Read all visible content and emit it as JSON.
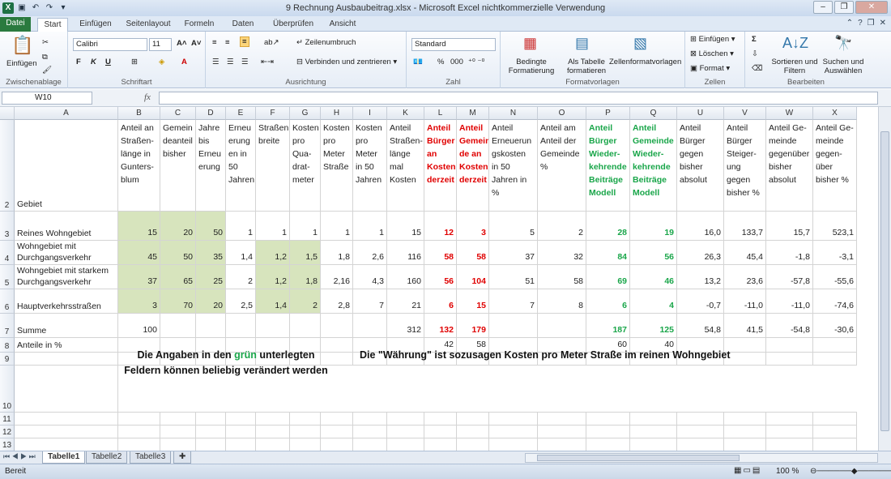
{
  "window": {
    "title": "9 Rechnung Ausbaubeitrag.xlsx  -  Microsoft Excel nichtkommerzielle Verwendung"
  },
  "ribbon_tabs": [
    {
      "label": "Datei"
    },
    {
      "label": "Start"
    },
    {
      "label": "Einfügen"
    },
    {
      "label": "Seitenlayout"
    },
    {
      "label": "Formeln"
    },
    {
      "label": "Daten"
    },
    {
      "label": "Überprüfen"
    },
    {
      "label": "Ansicht"
    }
  ],
  "ribbon": {
    "clipboard": {
      "label": "Zwischenablage",
      "paste": "Einfügen"
    },
    "font": {
      "label": "Schriftart",
      "name": "Calibri",
      "size": "11",
      "bold": "F",
      "italic": "K",
      "underline": "U"
    },
    "alignment": {
      "label": "Ausrichtung",
      "wrap": "Zeilenumbruch",
      "merge": "Verbinden und zentrieren"
    },
    "number": {
      "label": "Zahl",
      "format": "Standard",
      "percent": "%",
      "thousands": "000"
    },
    "styles": {
      "label": "Formatvorlagen",
      "conditional": "Bedingte Formatierung",
      "table": "Als Tabelle formatieren",
      "cell": "Zellenformatvorlagen"
    },
    "cells": {
      "label": "Zellen",
      "insert": "Einfügen",
      "delete": "Löschen",
      "format": "Format"
    },
    "editing": {
      "label": "Bearbeiten",
      "sum": "Σ",
      "sort": "Sortieren und Filtern",
      "find": "Suchen und Auswählen"
    }
  },
  "formula_bar": {
    "name_box": "W10",
    "fx": "fx",
    "value": ""
  },
  "columns": [
    "A",
    "B",
    "C",
    "D",
    "E",
    "F",
    "G",
    "H",
    "I",
    "K",
    "L",
    "M",
    "N",
    "O",
    "P",
    "Q",
    "U",
    "V",
    "W",
    "X"
  ],
  "row_numbers": [
    "2",
    "3",
    "4",
    "5",
    "6",
    "7",
    "8",
    "9",
    "10",
    "11",
    "12",
    "13"
  ],
  "headers": {
    "A": "Gebiet",
    "B": "Anteil an Straßen-länge in Gunters-blum",
    "C": "Gemein deanteil bisher",
    "D": "Jahre bis Erneu erung",
    "E": "Erneu erung en in 50 Jahren",
    "F": "Straßen breite",
    "G": "Kosten pro Qua-drat-meter",
    "H": "Kosten pro Meter Straße",
    "I": "Kosten pro Meter in 50 Jahren",
    "K": "Anteil Straßen-länge mal Kosten",
    "L": "Anteil Bürger an Kosten derzeit",
    "M": "Anteil Gemein de an Kosten derzeit",
    "N": "Anteil Erneuerun gskosten in 50 Jahren in %",
    "O": "Anteil am Anteil der Gemeinde %",
    "P": "Anteil Bürger Wieder-kehrende Beiträge Modell",
    "Q": "Anteil Gemeinde Wieder-kehrende Beiträge Modell",
    "U": "Anteil Bürger gegen bisher absolut",
    "V": "Anteil Bürger Steiger-ung gegen bisher %",
    "W": "Anteil Ge-meinde gegenüber bisher absolut",
    "X": "Anteil Ge-meinde gegen-über bisher %"
  },
  "rows": [
    {
      "A": "Reines Wohngebiet",
      "B": "15",
      "C": "20",
      "D": "50",
      "E": "1",
      "F": "1",
      "G": "1",
      "H": "1",
      "I": "1",
      "K": "15",
      "L": "12",
      "M": "3",
      "N": "5",
      "O": "2",
      "P": "28",
      "Q": "19",
      "U": "16,0",
      "V": "133,7",
      "W": "15,7",
      "X": "523,1"
    },
    {
      "A": "Wohngebiet mit Durchgangsverkehr",
      "B": "45",
      "C": "50",
      "D": "35",
      "E": "1,4",
      "F": "1,2",
      "G": "1,5",
      "H": "1,8",
      "I": "2,6",
      "K": "116",
      "L": "58",
      "M": "58",
      "N": "37",
      "O": "32",
      "P": "84",
      "Q": "56",
      "U": "26,3",
      "V": "45,4",
      "W": "-1,8",
      "X": "-3,1"
    },
    {
      "A": "Wohngebiet mit starkem Durchgangsverkehr",
      "B": "37",
      "C": "65",
      "D": "25",
      "E": "2",
      "F": "1,2",
      "G": "1,8",
      "H": "2,16",
      "I": "4,3",
      "K": "160",
      "L": "56",
      "M": "104",
      "N": "51",
      "O": "58",
      "P": "69",
      "Q": "46",
      "U": "13,2",
      "V": "23,6",
      "W": "-57,8",
      "X": "-55,6"
    },
    {
      "A": "Hauptverkehrsstraßen",
      "B": "3",
      "C": "70",
      "D": "20",
      "E": "2,5",
      "F": "1,4",
      "G": "2",
      "H": "2,8",
      "I": "7",
      "K": "21",
      "L": "6",
      "M": "15",
      "N": "7",
      "O": "8",
      "P": "6",
      "Q": "4",
      "U": "-0,7",
      "V": "-11,0",
      "W": "-11,0",
      "X": "-74,6"
    }
  ],
  "sum_row": {
    "A": "Summe",
    "B": "100",
    "K": "312",
    "L": "132",
    "M": "179",
    "P": "187",
    "Q": "125",
    "U": "54,8",
    "V": "41,5",
    "W": "-54,8",
    "X": "-30,6"
  },
  "share_row": {
    "A": "Anteile in %",
    "L": "42",
    "M": "58",
    "P": "60",
    "Q": "40"
  },
  "notes": {
    "left_before": "Die Angaben in den ",
    "left_green": "grün",
    "left_after": " unterlegten Feldern können beliebig verändert werden",
    "right": "Die \"Währung\" ist sozusagen Kosten pro Meter Straße im reinen Wohngebiet"
  },
  "sheets": [
    {
      "label": "Tabelle1"
    },
    {
      "label": "Tabelle2"
    },
    {
      "label": "Tabelle3"
    }
  ],
  "status": {
    "ready": "Bereit",
    "zoom": "100 %"
  },
  "colors": {
    "green_fill": "#d7e4bd",
    "red_text": "#e00000",
    "green_text": "#1aa64a"
  }
}
